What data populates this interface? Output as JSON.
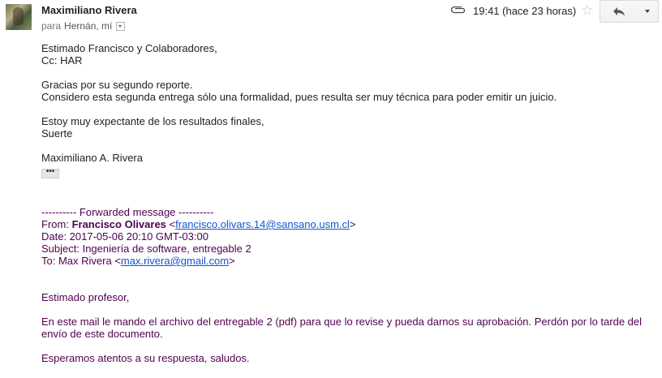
{
  "header": {
    "sender_name": "Maximiliano Rivera",
    "recipients_prefix": "para",
    "recipients": "Hernán, mí",
    "time": "19:41 (hace 23 horas)",
    "icons": {
      "attachment": "paperclip-icon",
      "star": "star-icon",
      "reply": "reply-icon",
      "more": "chevron-down-icon"
    }
  },
  "message": {
    "greeting": "Estimado Francisco y Colaboradores,",
    "cc": "Cc: HAR",
    "line1": "Gracias por su segundo reporte.",
    "line2": "Considero esta segunda entrega sólo una formalidad, pues resulta ser muy técnica para poder emitir un juicio.",
    "line3": "Estoy muy expectante de los resultados finales,",
    "line4": "Suerte",
    "signature": "Maximiliano A. Rivera",
    "ellipsis": "•••"
  },
  "forwarded": {
    "divider": "---------- Forwarded message ----------",
    "from_label": "From: ",
    "from_name": "Francisco Olivares",
    "from_email": "francisco.olivars.14@sansano.usm.cl",
    "date": "Date: 2017-05-06 20:10 GMT-03:00",
    "subject": "Subject: Ingeniería de software, entregable 2",
    "to_label": "To: Max Rivera ",
    "to_email": "max.rivera@gmail.com",
    "salutation": "Estimado profesor,",
    "body1": "En este mail le mando el archivo del entregable 2 (pdf) para que lo revise y pueda darnos su aprobación. Perdón por lo tarde del envío de este documento.",
    "closing": "Esperamos atentos a su respuesta, saludos."
  },
  "colors": {
    "forward_text": "#500050",
    "link": "#1155cc"
  }
}
